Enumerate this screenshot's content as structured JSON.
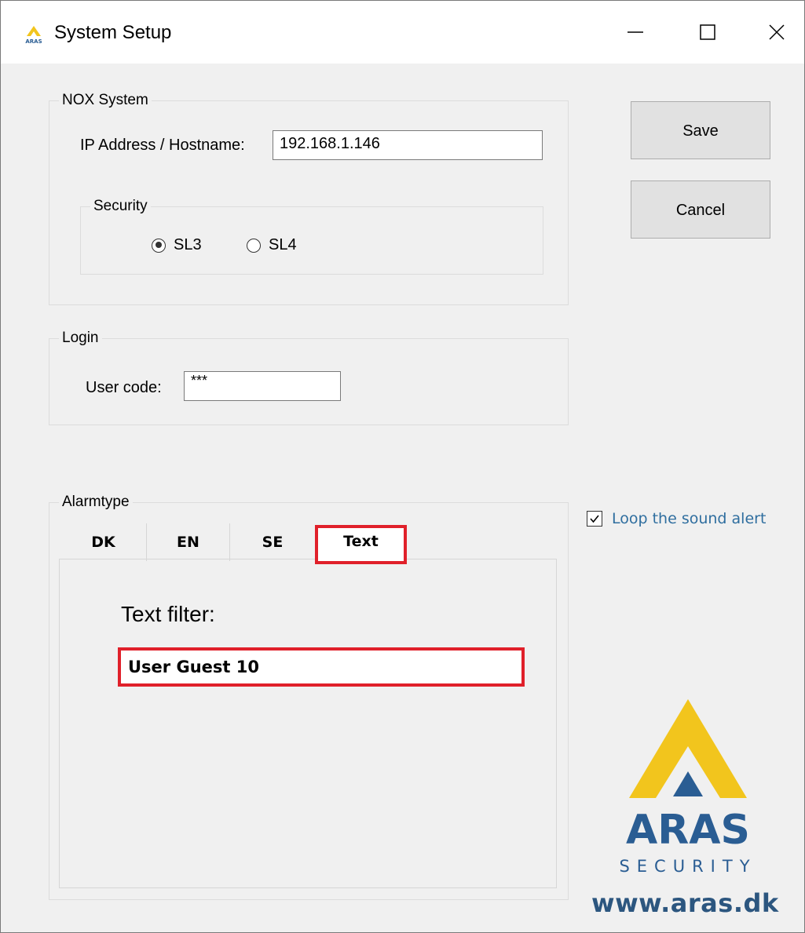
{
  "window": {
    "title": "System Setup",
    "app_icon": "aras-logo-icon",
    "controls": {
      "minimize_icon": "minimize-icon",
      "maximize_icon": "maximize-icon",
      "close_icon": "close-icon"
    }
  },
  "nox_system": {
    "legend": "NOX System",
    "ip_label": "IP Address / Hostname:",
    "ip_value": "192.168.1.146",
    "security": {
      "legend": "Security",
      "options": [
        {
          "label": "SL3",
          "checked": true
        },
        {
          "label": "SL4",
          "checked": false
        }
      ]
    }
  },
  "login": {
    "legend": "Login",
    "user_code_label": "User code:",
    "user_code_value": "***"
  },
  "buttons": {
    "save": "Save",
    "cancel": "Cancel"
  },
  "alarmtype": {
    "legend": "Alarmtype",
    "tabs": [
      {
        "label": "DK",
        "selected": false
      },
      {
        "label": "EN",
        "selected": false
      },
      {
        "label": "SE",
        "selected": false
      },
      {
        "label": "Text",
        "selected": true
      }
    ],
    "text_filter_label": "Text filter:",
    "text_filter_value": "User Guest 10"
  },
  "loop_sound": {
    "label": "Loop the sound alert",
    "checked": true
  },
  "branding": {
    "logo_top": "ARAS",
    "logo_bottom": "SECURITY",
    "url": "www.aras.dk",
    "logo_small_text": "ARAS",
    "colors": {
      "yellow": "#f2c51d",
      "blue": "#2a5d93",
      "highlight": "#e0202a"
    }
  }
}
